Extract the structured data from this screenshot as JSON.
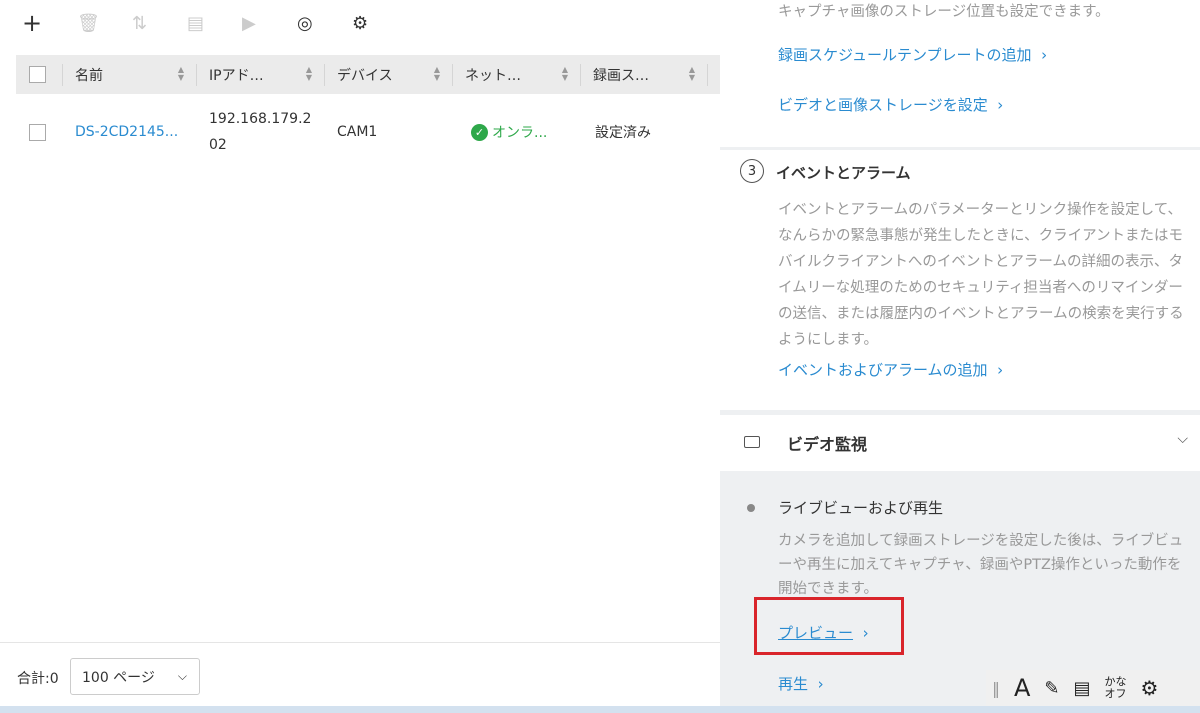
{
  "toolbar": {
    "icons": [
      "plus-icon",
      "trash-icon",
      "sort-icon",
      "export-icon",
      "video-icon",
      "network-camera-icon",
      "location-settings-icon"
    ]
  },
  "table": {
    "headers": [
      "名前",
      "IPアド…",
      "デバイス",
      "ネット…",
      "録画ス…"
    ],
    "rows": [
      {
        "name": "DS-2CD2145...",
        "ip": "192.168.179.2\n02",
        "device": "CAM1",
        "network": "オンラ...",
        "recording": "設定済み"
      }
    ]
  },
  "footer": {
    "total": "合計:0",
    "page_size": "100 ページ"
  },
  "right": {
    "storage_desc_tail": "キャプチャ画像のストレージ位置も設定できます。",
    "add_schedule": "録画スケジュールテンプレートの追加",
    "set_storage": "ビデオと画像ストレージを設定",
    "event_step": "3",
    "event_title": "イベントとアラーム",
    "event_desc": "イベントとアラームのパラメーターとリンク操作を設定して、なんらかの緊急事態が発生したときに、クライアントまたはモバイルクライアントへのイベントとアラームの詳細の表示、タイムリーな処理のためのセキュリティ担当者へのリマインダーの送信、または履歴内のイベントとアラームの検索を実行するようにします。",
    "add_event": "イベントおよびアラームの追加",
    "video_title": "ビデオ監視",
    "live_title": "ライブビューおよび再生",
    "live_desc": "カメラを追加して録画ストレージを設定した後は、ライブビューや再生に加えてキャプチャ、録画やPTZ操作といった動作を開始できます。",
    "preview": "プレビュー",
    "playback": "再生"
  },
  "ime": {
    "mode": "A",
    "kana": "かな",
    "kana_off": "オフ"
  },
  "colors": {
    "link": "#2a8bd0",
    "online": "#2ea84a",
    "highlight": "#d9252b"
  }
}
